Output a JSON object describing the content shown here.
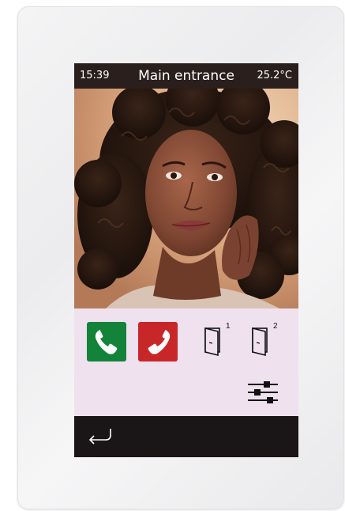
{
  "status_bar": {
    "time": "15:39",
    "title": "Main entrance",
    "temperature": "25.2°C"
  },
  "camera_feed": {
    "description_icon": "video-feed"
  },
  "controls": {
    "answer_icon": "phone-answer-icon",
    "hangup_icon": "phone-hangup-icon",
    "door_1_label": "1",
    "door_2_label": "2",
    "settings_icon": "equalizer-sliders-icon"
  },
  "nav": {
    "back_icon": "back-arrow-icon"
  },
  "colors": {
    "answer": "#14833a",
    "hangup": "#c8272a",
    "status_bar_bg": "#2a1f1c",
    "panel_bg": "#f0e1ef",
    "nav_bg": "#1a1516"
  }
}
